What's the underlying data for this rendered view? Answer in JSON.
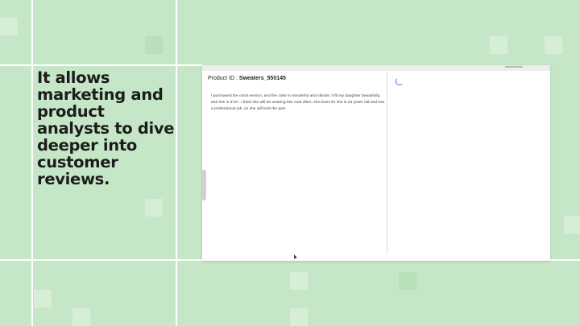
{
  "headline": "It allows marketing and product analysts to dive deeper into customer reviews.",
  "window": {
    "product_label": "Product ID : ",
    "product_id": "Sweaters_550145",
    "review_text": "I purchased the coral version, and the color is wonderful and vibrant. it fit my daughter beautifully, and she is 5'10\". i think she will be wearing this coat often, she loves it!! she is 23 years old and has a professional job, so she will look the part.",
    "loading": true
  },
  "colors": {
    "background": "#c6e7c7",
    "accent": "#3a7bd5"
  }
}
